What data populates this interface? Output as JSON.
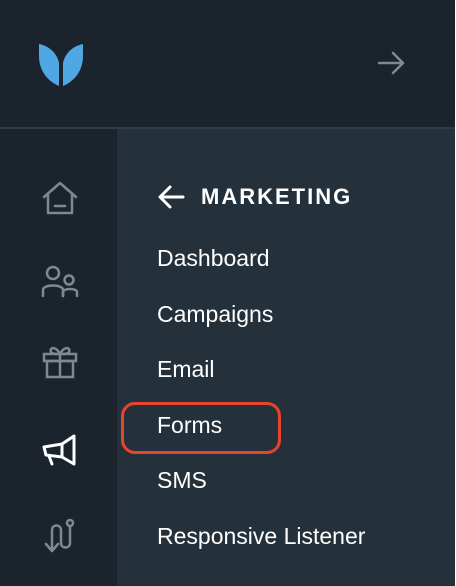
{
  "topbar": {
    "logo_icon": "logo-icon",
    "expand_icon": "arrow-right-icon"
  },
  "rail": {
    "items": [
      {
        "icon": "home-icon",
        "active": false
      },
      {
        "icon": "people-icon",
        "active": false
      },
      {
        "icon": "gift-icon",
        "active": false
      },
      {
        "icon": "megaphone-icon",
        "active": true
      },
      {
        "icon": "journey-icon",
        "active": false
      }
    ]
  },
  "panel": {
    "back_icon": "arrow-left-icon",
    "title": "MARKETING",
    "items": [
      {
        "label": "Dashboard"
      },
      {
        "label": "Campaigns"
      },
      {
        "label": "Email"
      },
      {
        "label": "Forms",
        "highlighted": true
      },
      {
        "label": "SMS"
      },
      {
        "label": "Responsive Listener"
      }
    ]
  },
  "colors": {
    "background": "#1b232c",
    "panel": "#25313a",
    "accent_blue": "#4fa8e4",
    "icon_muted": "#7d8a94",
    "highlight": "#e8432c"
  }
}
